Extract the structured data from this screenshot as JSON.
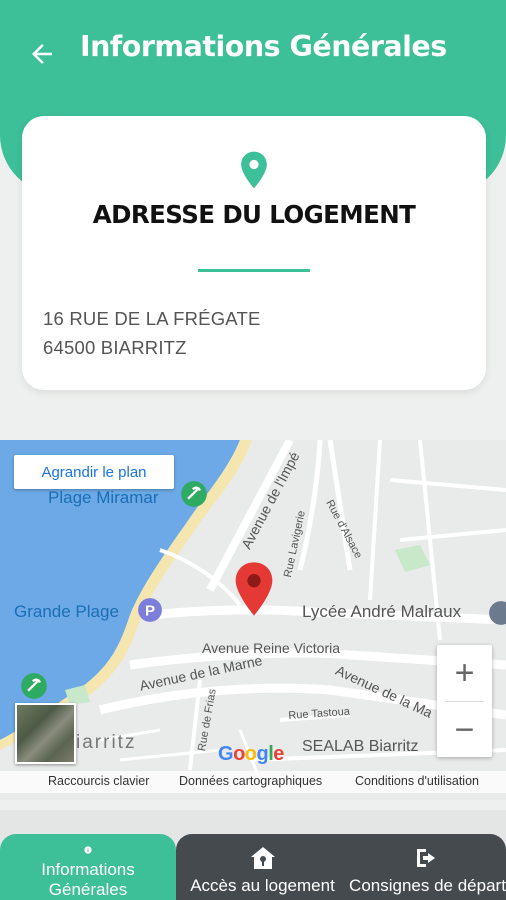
{
  "header": {
    "title": "Informations Générales",
    "back_icon": "arrow-left-icon",
    "color": "#3dbf98"
  },
  "address_card": {
    "icon": "map-pin-icon",
    "title": "ADRESSE DU LOGEMENT",
    "street": "16 RUE DE LA FRÉGATE",
    "city": "64500 BIARRITZ"
  },
  "map": {
    "enlarge_label": "Agrandir le plan",
    "labels": {
      "plage_miramar": "Plage Miramar",
      "grande_plage": "Grande Plage",
      "lycee": "Lycée André Malraux",
      "avenue_reine": "Avenue Reine Victoria",
      "avenue_marne_1": "Avenue de la Marne",
      "avenue_marne_2": "Avenue de la Ma",
      "avenue_imperatrice": "Avenue de l'Impé",
      "rue_lavigerie": "Rue Lavigerie",
      "rue_alsace": "Rue d'Alsace",
      "rue_tastoua": "Rue Tastoua",
      "rue_frias": "Rue de Frias",
      "biarritz": "iarritz",
      "sealab": "SEALAB Biarritz",
      "google": "Google"
    },
    "zoom_in": "+",
    "zoom_out": "−",
    "attribution": {
      "shortcuts": "Raccourcis clavier",
      "data": "Données cartographiques",
      "terms": "Conditions d'utilisation"
    }
  },
  "bottom_nav": {
    "items": [
      {
        "label": "Informations Générales",
        "icon": "info-icon",
        "active": true
      },
      {
        "label": "Accès au logement",
        "icon": "house-key-icon",
        "active": false
      },
      {
        "label": "Consignes de départ",
        "icon": "exit-icon",
        "active": false
      }
    ]
  }
}
